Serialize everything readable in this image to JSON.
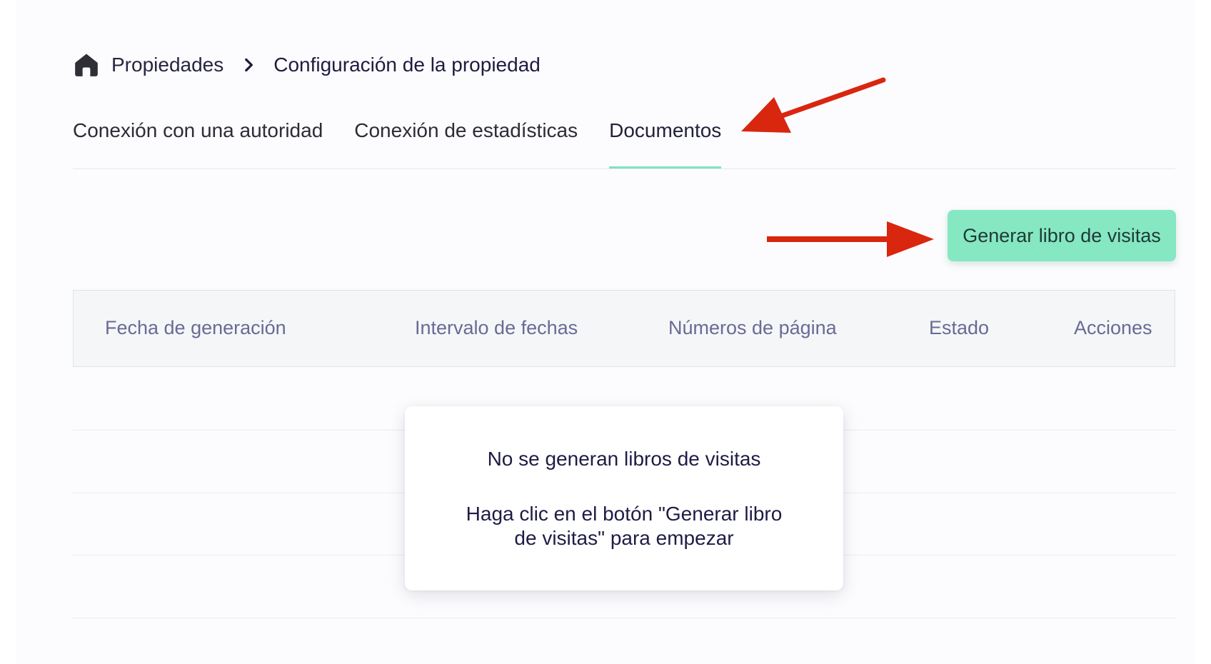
{
  "breadcrumb": {
    "home_icon": "home-icon",
    "items": [
      "Propiedades",
      "Configuración de la propiedad"
    ],
    "separator_icon": "chevron-right-icon"
  },
  "tabs": [
    {
      "label": "Conexión con una autoridad",
      "active": false
    },
    {
      "label": "Conexión de estadísticas",
      "active": false
    },
    {
      "label": "Documentos",
      "active": true
    }
  ],
  "actions": {
    "generate_label": "Generar libro de visitas"
  },
  "table": {
    "columns": [
      "Fecha de generación",
      "Intervalo de fechas",
      "Números de página",
      "Estado",
      "Acciones"
    ],
    "rows": []
  },
  "empty_state": {
    "title": "No se generan libros de visitas",
    "hint": "Haga clic en el botón \"Generar libro de visitas\" para empezar"
  },
  "annotations": {
    "arrow_color": "#d9260f"
  },
  "colors": {
    "accent": "#86e7c3",
    "tab_underline": "#7fe3c0"
  }
}
